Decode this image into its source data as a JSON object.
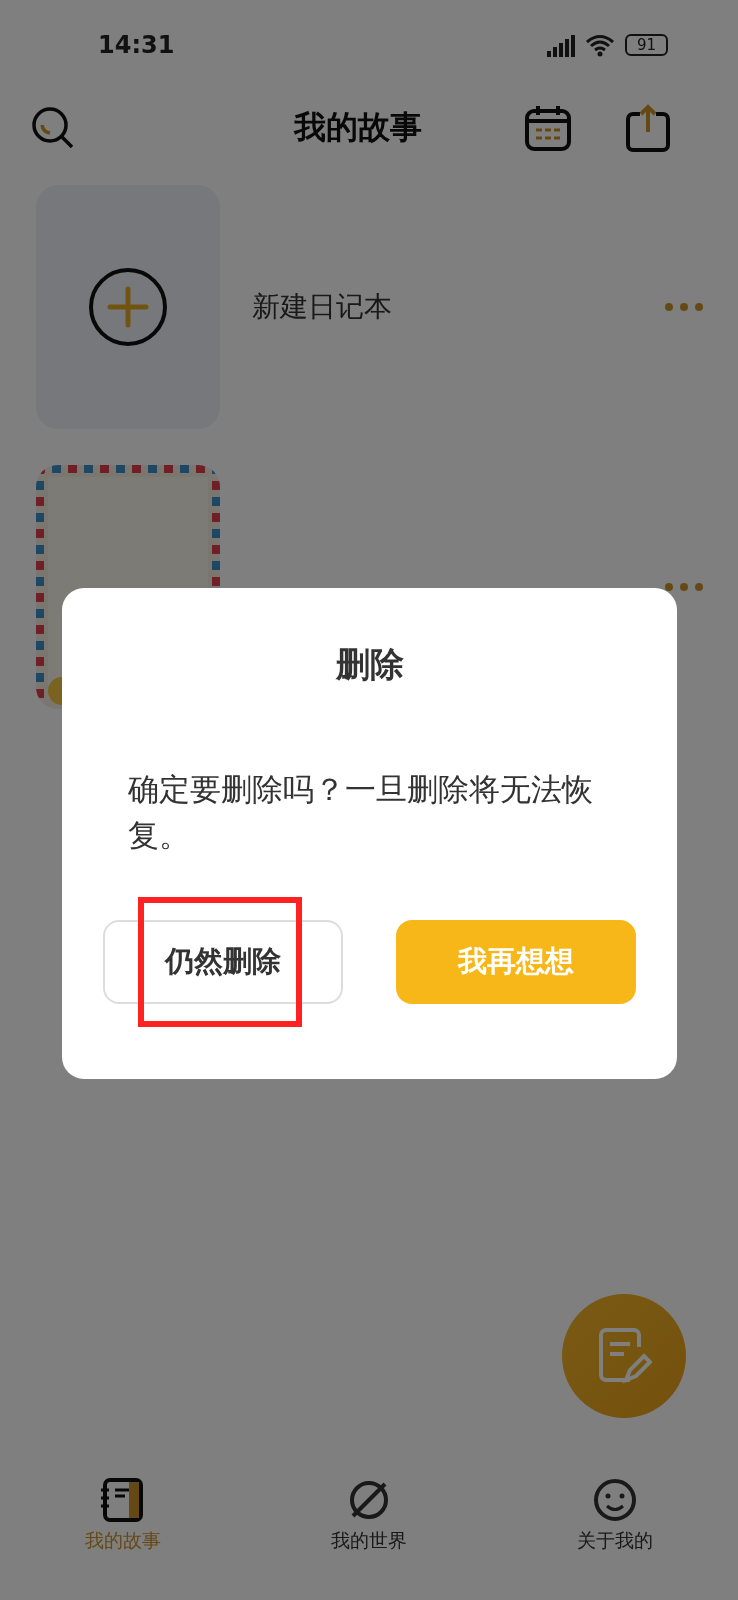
{
  "status_bar": {
    "time": "14:31",
    "battery": "91"
  },
  "header": {
    "title": "我的故事"
  },
  "notebooks": [
    {
      "kind": "new",
      "title": "新建日记本"
    },
    {
      "kind": "picture"
    }
  ],
  "dialog": {
    "title": "删除",
    "message": "确定要删除吗？一旦删除将无法恢复。",
    "buttons": [
      {
        "label": "仍然删除",
        "kind": "secondary"
      },
      {
        "label": "我再想想",
        "kind": "primary"
      }
    ]
  },
  "tabs": [
    {
      "label": "我的故事",
      "selected": true
    },
    {
      "label": "我的世界",
      "selected": false
    },
    {
      "label": "关于我的",
      "selected": false
    }
  ]
}
